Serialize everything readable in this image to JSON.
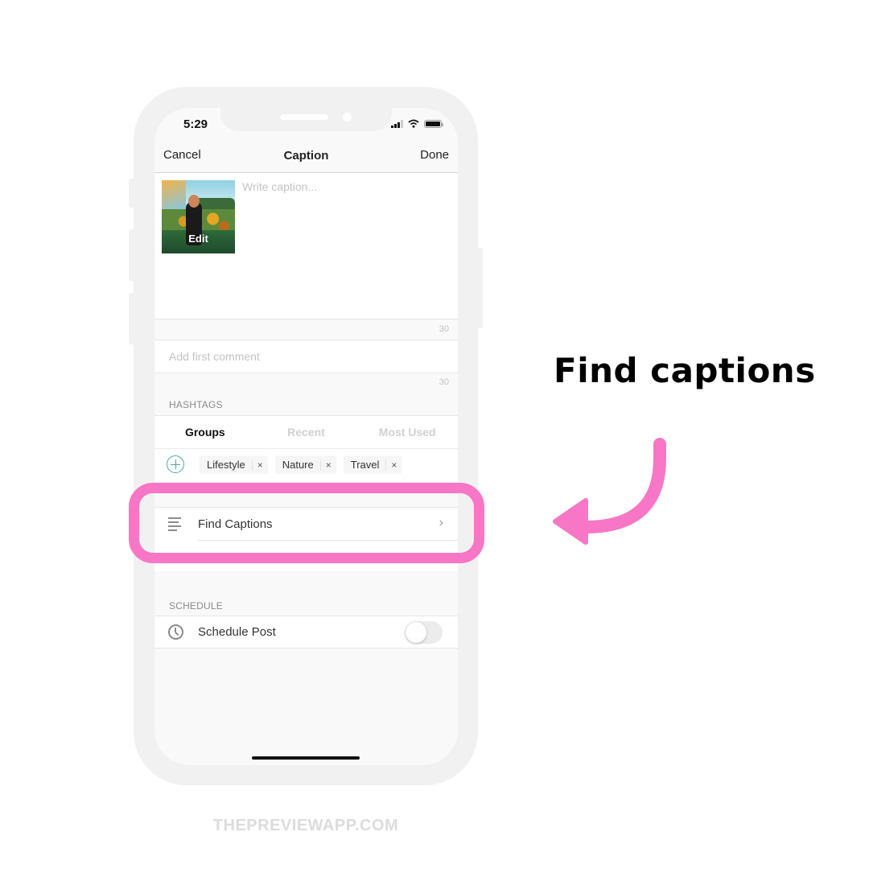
{
  "status_bar": {
    "time": "5:29",
    "icons": [
      "cellular-signal-icon",
      "wifi-icon",
      "battery-icon"
    ]
  },
  "nav": {
    "cancel_label": "Cancel",
    "title": "Caption",
    "done_label": "Done"
  },
  "caption": {
    "thumbnail_overlay": "Edit",
    "placeholder": "Write caption...",
    "value": "",
    "remaining_count": "30"
  },
  "first_comment": {
    "placeholder": "Add first comment",
    "value": "",
    "remaining_count": "30"
  },
  "hashtags": {
    "section_label": "HASHTAGS",
    "tabs": [
      {
        "label": "Groups",
        "active": true
      },
      {
        "label": "Recent",
        "active": false
      },
      {
        "label": "Most Used",
        "active": false
      }
    ],
    "groups": [
      {
        "label": "Lifestyle"
      },
      {
        "label": "Nature"
      },
      {
        "label": "Travel"
      }
    ],
    "remove_glyph": "×"
  },
  "tools": {
    "items": [
      {
        "label": "Find Captions",
        "icon": "text-lines-icon",
        "chevron": "›"
      }
    ]
  },
  "schedule": {
    "section_label": "SCHEDULE",
    "label": "Schedule Post",
    "toggle_on": false
  },
  "annotation": {
    "title": "Find captions",
    "highlight_color": "#f777c6"
  },
  "footer": {
    "brand": "THEPREVIEWAPP.COM"
  }
}
